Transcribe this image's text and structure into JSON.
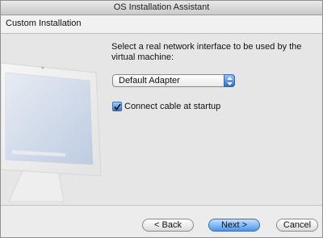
{
  "window": {
    "title": "OS Installation Assistant"
  },
  "header": {
    "title": "Custom Installation"
  },
  "main": {
    "prompt": "Select a real network interface to be used by the virtual machine:",
    "interface_select": {
      "selected": "Default Adapter"
    },
    "connect_checkbox": {
      "label": "Connect cable at startup",
      "checked": true
    }
  },
  "footer": {
    "back_label": "< Back",
    "next_label": "Next >",
    "cancel_label": "Cancel"
  },
  "colors": {
    "accent": "#3b7fe0",
    "window_bg": "#ececec"
  }
}
